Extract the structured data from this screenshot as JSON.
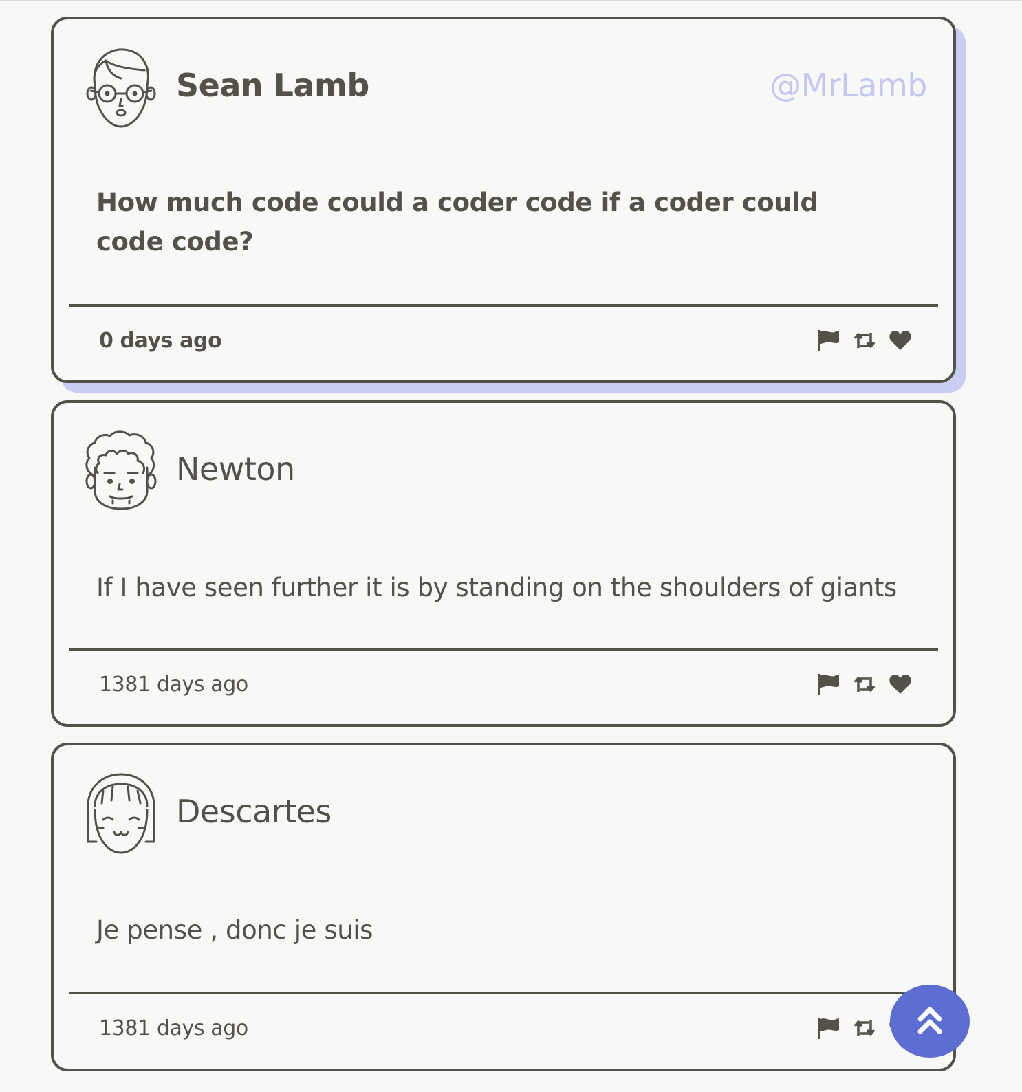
{
  "tweets": [
    {
      "avatar_icon": "avatar-glasses-icon",
      "name": "Sean Lamb",
      "handle": "@MrLamb",
      "content": "How much code could a coder code if a coder could code code?",
      "time": "0 days ago"
    },
    {
      "avatar_icon": "avatar-curly-hair-icon",
      "name": "Newton",
      "content": "If I have seen further it is by standing on the shoulders of giants",
      "time": "1381 days ago"
    },
    {
      "avatar_icon": "avatar-bangs-icon",
      "name": "Descartes",
      "content": "Je pense , donc je suis",
      "time": "1381 days ago"
    }
  ],
  "actions": [
    "flag-icon",
    "retweet-icon",
    "heart-icon"
  ],
  "scroll_top_icon": "double-chevron-up-icon",
  "colors": {
    "text": "#545149",
    "accent": "#5d6ed3",
    "handle": "#c3c8f3",
    "shadow": "#c8cdf4",
    "background": "#f7f7f5"
  }
}
